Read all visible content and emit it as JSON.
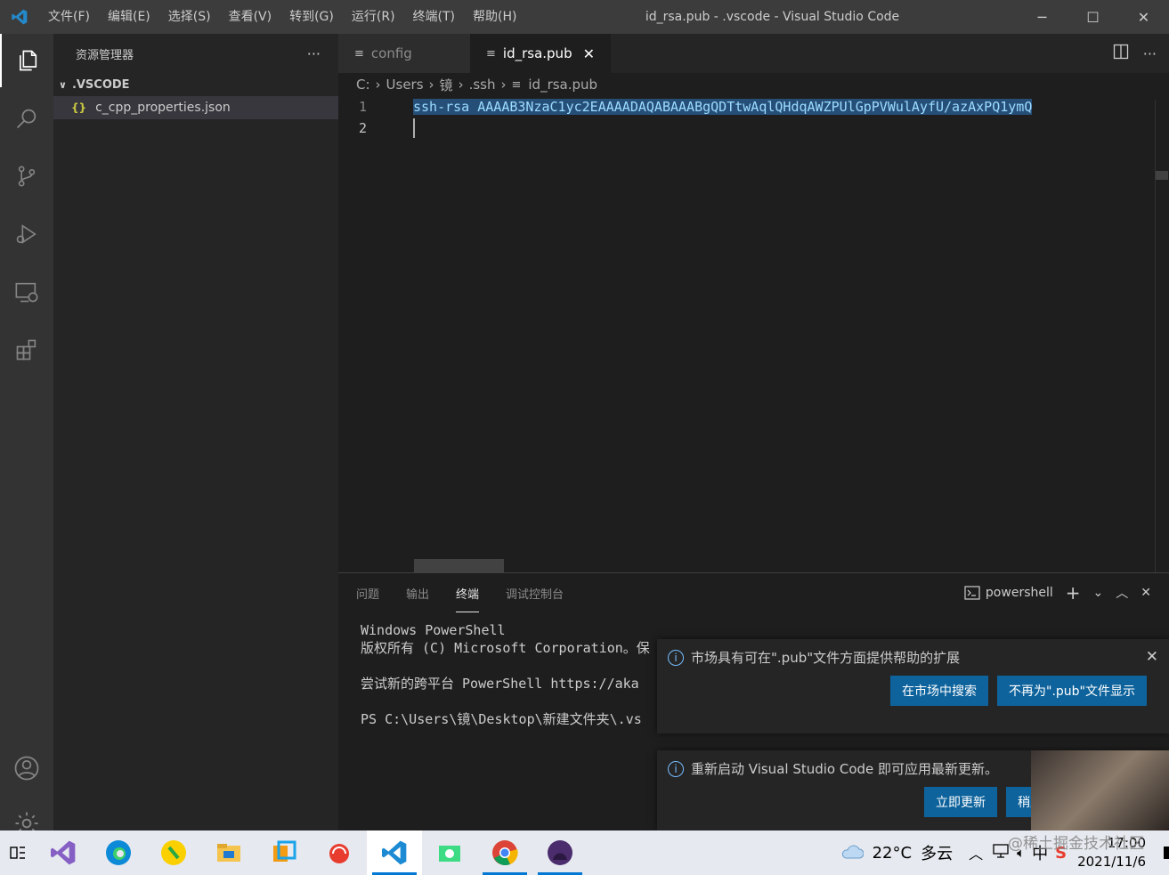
{
  "window": {
    "title": "id_rsa.pub - .vscode - Visual Studio Code",
    "minimize": "─",
    "maximize": "☐",
    "close": "✕"
  },
  "menus": [
    "文件(F)",
    "编辑(E)",
    "选择(S)",
    "查看(V)",
    "转到(G)",
    "运行(R)",
    "终端(T)",
    "帮助(H)"
  ],
  "activity_icons": [
    "explorer-icon",
    "search-icon",
    "source-control-icon",
    "run-debug-icon",
    "remote-explorer-icon",
    "extensions-icon",
    "account-icon",
    "settings-gear-icon"
  ],
  "sidebar": {
    "title": "资源管理器",
    "more": "···",
    "section": ".VSCODE",
    "file_icon": "{}",
    "file": "c_cpp_properties.json"
  },
  "tabs": [
    {
      "label": "config",
      "icon": "≡"
    },
    {
      "label": "id_rsa.pub",
      "icon": "≡",
      "close": "✕"
    }
  ],
  "breadcrumbs": [
    "C:",
    "Users",
    "镜",
    ".ssh",
    "id_rsa.pub"
  ],
  "editor": {
    "lines": [
      {
        "num": "1",
        "text": "ssh-rsa AAAAB3NzaC1yc2EAAAADAQABAAABgQDTtwAqlQHdqAWZPUlGpPVWulAyfU/azAxPQ1ymQ"
      },
      {
        "num": "2",
        "text": ""
      }
    ]
  },
  "panel": {
    "tabs": [
      "问题",
      "输出",
      "终端",
      "调试控制台"
    ],
    "active_tab": "终端",
    "shell": "powershell",
    "add": "+",
    "chev": "⌄",
    "up": "︿",
    "close": "✕"
  },
  "terminal": {
    "lines": [
      "Windows PowerShell",
      "版权所有 (C) Microsoft Corporation。保",
      "",
      "尝试新的跨平台 PowerShell https://aka",
      "",
      "PS C:\\Users\\镜\\Desktop\\新建文件夹\\.vs"
    ]
  },
  "notifications": [
    {
      "message": "市场具有可在\".pub\"文件方面提供帮助的扩展",
      "close": "✕",
      "buttons": [
        "在市场中搜索",
        "不再为\".pub\"文件显示"
      ]
    },
    {
      "message": "重新启动 Visual Studio Code 即可应用最新更新。",
      "buttons": [
        "立即更新",
        "稍后"
      ]
    }
  ],
  "taskbar": {
    "weather_temp": "22°C",
    "weather_text": "多云",
    "ime": "中",
    "time": "17:00",
    "date": "2021/11/6",
    "watermark": "@稀土掘金技术社区"
  },
  "colors": {
    "accent": "#0e639c",
    "selection": "#264f78",
    "titlebar": "#3c3c3c",
    "activity": "#333333",
    "sidebar": "#252526"
  }
}
